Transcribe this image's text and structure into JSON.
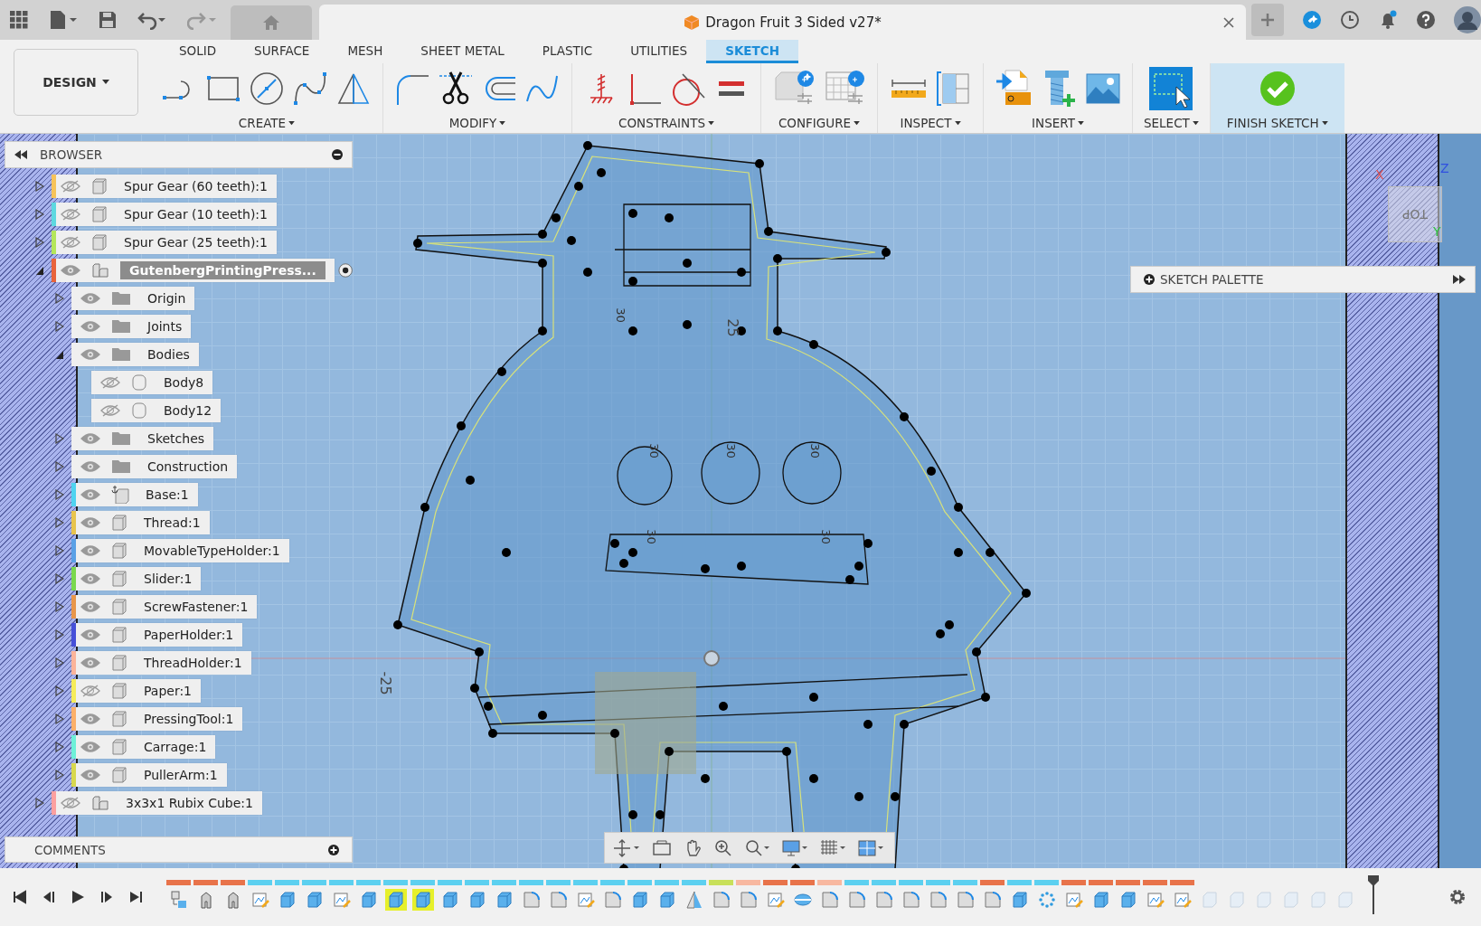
{
  "document_tab": {
    "title": "Dragon Fruit 3 Sided v27*"
  },
  "notifications": {
    "unread": true
  },
  "workspace": {
    "label": "DESIGN"
  },
  "tabs": [
    {
      "label": "SOLID",
      "selected": false
    },
    {
      "label": "SURFACE",
      "selected": false
    },
    {
      "label": "MESH",
      "selected": false
    },
    {
      "label": "SHEET METAL",
      "selected": false
    },
    {
      "label": "PLASTIC",
      "selected": false
    },
    {
      "label": "UTILITIES",
      "selected": false
    },
    {
      "label": "SKETCH",
      "selected": true
    }
  ],
  "tool_groups": [
    {
      "label": "CREATE",
      "highlighted": false,
      "tools": [
        {
          "kind": "line"
        },
        {
          "kind": "rect"
        },
        {
          "kind": "circle"
        },
        {
          "kind": "spline"
        },
        {
          "kind": "mirror"
        }
      ]
    },
    {
      "label": "MODIFY",
      "highlighted": false,
      "tools": [
        {
          "kind": "fillet"
        },
        {
          "kind": "trim"
        },
        {
          "kind": "offset"
        },
        {
          "kind": "curve"
        }
      ]
    },
    {
      "label": "CONSTRAINTS",
      "highlighted": false,
      "tools": [
        {
          "kind": "fix"
        },
        {
          "kind": "perpendicular"
        },
        {
          "kind": "tangent"
        },
        {
          "kind": "equal"
        }
      ]
    },
    {
      "label": "CONFIGURE",
      "highlighted": false,
      "tools": [
        {
          "kind": "configure"
        },
        {
          "kind": "table"
        }
      ]
    },
    {
      "label": "INSPECT",
      "highlighted": false,
      "tools": [
        {
          "kind": "measure"
        },
        {
          "kind": "section"
        }
      ]
    },
    {
      "label": "INSERT",
      "highlighted": false,
      "tools": [
        {
          "kind": "svg"
        },
        {
          "kind": "bolt"
        },
        {
          "kind": "image"
        }
      ]
    },
    {
      "label": "SELECT",
      "highlighted": false,
      "tools": [
        {
          "kind": "select"
        }
      ]
    },
    {
      "label": "FINISH SKETCH",
      "highlighted": true,
      "tools": [
        {
          "kind": "finish"
        }
      ]
    }
  ],
  "browser": {
    "title": "BROWSER",
    "items": [
      {
        "label": "Spur Gear (60 teeth):1",
        "kind": "component",
        "color": "#f7c35a",
        "visible": false,
        "expanded": false,
        "selected": false
      },
      {
        "label": "Spur Gear (10 teeth):1",
        "kind": "component",
        "color": "#5ed8e0",
        "visible": false,
        "expanded": false,
        "selected": false
      },
      {
        "label": "Spur Gear (25 teeth):1",
        "kind": "component",
        "color": "#b4e65a",
        "visible": false,
        "expanded": false,
        "selected": false
      },
      {
        "label": "GutenbergPrintingPress...",
        "kind": "assembly",
        "color": "#e8633c",
        "visible": true,
        "expanded": true,
        "selected": true,
        "active": true,
        "children": [
          {
            "label": "Origin",
            "kind": "folder",
            "visible": true,
            "expanded": false,
            "selected": false
          },
          {
            "label": "Joints",
            "kind": "folder",
            "visible": true,
            "expanded": false,
            "selected": false
          },
          {
            "label": "Bodies",
            "kind": "folder",
            "visible": true,
            "expanded": true,
            "selected": false,
            "children": [
              {
                "label": "Body8",
                "kind": "body",
                "visible": false,
                "selected": false
              },
              {
                "label": "Body12",
                "kind": "body",
                "visible": false,
                "selected": false
              }
            ]
          },
          {
            "label": "Sketches",
            "kind": "folder",
            "visible": true,
            "expanded": false,
            "selected": false
          },
          {
            "label": "Construction",
            "kind": "folder",
            "visible": true,
            "expanded": false,
            "selected": false
          },
          {
            "label": "Base:1",
            "kind": "grounded",
            "color": "#4fd3f0",
            "visible": true,
            "expanded": false,
            "selected": false
          },
          {
            "label": "Thread:1",
            "kind": "component",
            "color": "#e8c44e",
            "visible": true,
            "expanded": false,
            "selected": false
          },
          {
            "label": "MovableTypeHolder:1",
            "kind": "component",
            "color": "#5aa0e6",
            "visible": true,
            "expanded": false,
            "selected": false
          },
          {
            "label": "Slider:1",
            "kind": "component",
            "color": "#7ad84e",
            "visible": true,
            "expanded": false,
            "selected": false
          },
          {
            "label": "ScrewFastener:1",
            "kind": "component",
            "color": "#e8964a",
            "visible": true,
            "expanded": false,
            "selected": false
          },
          {
            "label": "PaperHolder:1",
            "kind": "component",
            "color": "#4650d8",
            "visible": true,
            "expanded": false,
            "selected": false
          },
          {
            "label": "ThreadHolder:1",
            "kind": "component",
            "color": "#fbb49a",
            "visible": true,
            "expanded": false,
            "selected": false
          },
          {
            "label": "Paper:1",
            "kind": "component",
            "color": "#f6ec5a",
            "visible": false,
            "expanded": false,
            "selected": false
          },
          {
            "label": "PressingTool:1",
            "kind": "component",
            "color": "#fcb06a",
            "visible": true,
            "expanded": false,
            "selected": false
          },
          {
            "label": "Carrage:1",
            "kind": "component",
            "color": "#6ef0d8",
            "visible": true,
            "expanded": false,
            "selected": false
          },
          {
            "label": "PullerArm:1",
            "kind": "component",
            "color": "#d8d84e",
            "visible": true,
            "expanded": false,
            "selected": false
          }
        ]
      },
      {
        "label": "3x3x1 Rubix Cube:1",
        "kind": "assembly",
        "color": "#fca0a0",
        "visible": false,
        "expanded": false,
        "selected": false
      }
    ]
  },
  "comments": {
    "title": "COMMENTS"
  },
  "sketch_palette": {
    "title": "SKETCH PALETTE"
  },
  "view_cube": {
    "face": "TOP",
    "x": "X",
    "y": "Y",
    "z": "Z"
  },
  "canvas": {
    "labels": [
      {
        "text": "25",
        "kind": "vertical"
      },
      {
        "text": "-25",
        "kind": "vertical"
      },
      {
        "text": "30",
        "kind": "dim"
      },
      {
        "text": "30",
        "kind": "dim"
      },
      {
        "text": "30",
        "kind": "dim"
      },
      {
        "text": "30",
        "kind": "dim"
      },
      {
        "text": "30",
        "kind": "dim"
      },
      {
        "text": "30",
        "kind": "dim"
      }
    ]
  },
  "timeline": {
    "features": [
      {
        "kind": "component",
        "color": "#e8734a",
        "selected": false
      },
      {
        "kind": "joint",
        "color": "#e8734a",
        "selected": false
      },
      {
        "kind": "joint",
        "color": "#e8734a",
        "selected": false
      },
      {
        "kind": "sketch",
        "color": "#5cd0f0",
        "selected": false
      },
      {
        "kind": "extrude",
        "color": "#5cd0f0",
        "selected": false
      },
      {
        "kind": "extrude",
        "color": "#5cd0f0",
        "selected": false
      },
      {
        "kind": "sketch",
        "color": "#5cd0f0",
        "selected": false
      },
      {
        "kind": "extrude",
        "color": "#5cd0f0",
        "selected": false
      },
      {
        "kind": "extrude",
        "color": "#5cd0f0",
        "selected": true
      },
      {
        "kind": "extrude",
        "color": "#5cd0f0",
        "selected": true
      },
      {
        "kind": "extrude",
        "color": "#5cd0f0",
        "selected": false
      },
      {
        "kind": "extrude",
        "color": "#5cd0f0",
        "selected": false
      },
      {
        "kind": "extrude",
        "color": "#5cd0f0",
        "selected": false
      },
      {
        "kind": "fillet",
        "color": "#5cd0f0",
        "selected": false
      },
      {
        "kind": "fillet",
        "color": "#5cd0f0",
        "selected": false
      },
      {
        "kind": "sketch",
        "color": "#5cd0f0",
        "selected": false
      },
      {
        "kind": "fillet",
        "color": "#5cd0f0",
        "selected": false
      },
      {
        "kind": "extrude",
        "color": "#5cd0f0",
        "selected": false
      },
      {
        "kind": "extrude",
        "color": "#5cd0f0",
        "selected": false
      },
      {
        "kind": "mirror",
        "color": "#5cd0f0",
        "selected": false
      },
      {
        "kind": "fillet",
        "color": "#c8e05a",
        "selected": false
      },
      {
        "kind": "fillet",
        "color": "#f8b8a0",
        "selected": false
      },
      {
        "kind": "sketch",
        "color": "#e8734a",
        "selected": false
      },
      {
        "kind": "split",
        "color": "#e8734a",
        "selected": false
      },
      {
        "kind": "fillet",
        "color": "#f8b8a0",
        "selected": false
      },
      {
        "kind": "fillet",
        "color": "#5cd0f0",
        "selected": false
      },
      {
        "kind": "fillet",
        "color": "#5cd0f0",
        "selected": false
      },
      {
        "kind": "fillet",
        "color": "#5cd0f0",
        "selected": false
      },
      {
        "kind": "fillet",
        "color": "#5cd0f0",
        "selected": false
      },
      {
        "kind": "fillet",
        "color": "#5cd0f0",
        "selected": false
      },
      {
        "kind": "fillet",
        "color": "#e8734a",
        "selected": false
      },
      {
        "kind": "extrude",
        "color": "#5cd0f0",
        "selected": false
      },
      {
        "kind": "pattern",
        "color": "#5cd0f0",
        "selected": false
      },
      {
        "kind": "sketch",
        "color": "#e8734a",
        "selected": false
      },
      {
        "kind": "extrude",
        "color": "#e8734a",
        "selected": false
      },
      {
        "kind": "extrude",
        "color": "#e8734a",
        "selected": false
      },
      {
        "kind": "sketch",
        "color": "#e8734a",
        "selected": false
      },
      {
        "kind": "sketch",
        "color": "#e8734a",
        "selected": false
      },
      {
        "kind": "suppressed",
        "selected": false
      },
      {
        "kind": "suppressed",
        "selected": false
      },
      {
        "kind": "suppressed",
        "selected": false
      },
      {
        "kind": "suppressed",
        "selected": false
      },
      {
        "kind": "suppressed",
        "selected": false
      },
      {
        "kind": "suppressed",
        "selected": false
      }
    ]
  }
}
